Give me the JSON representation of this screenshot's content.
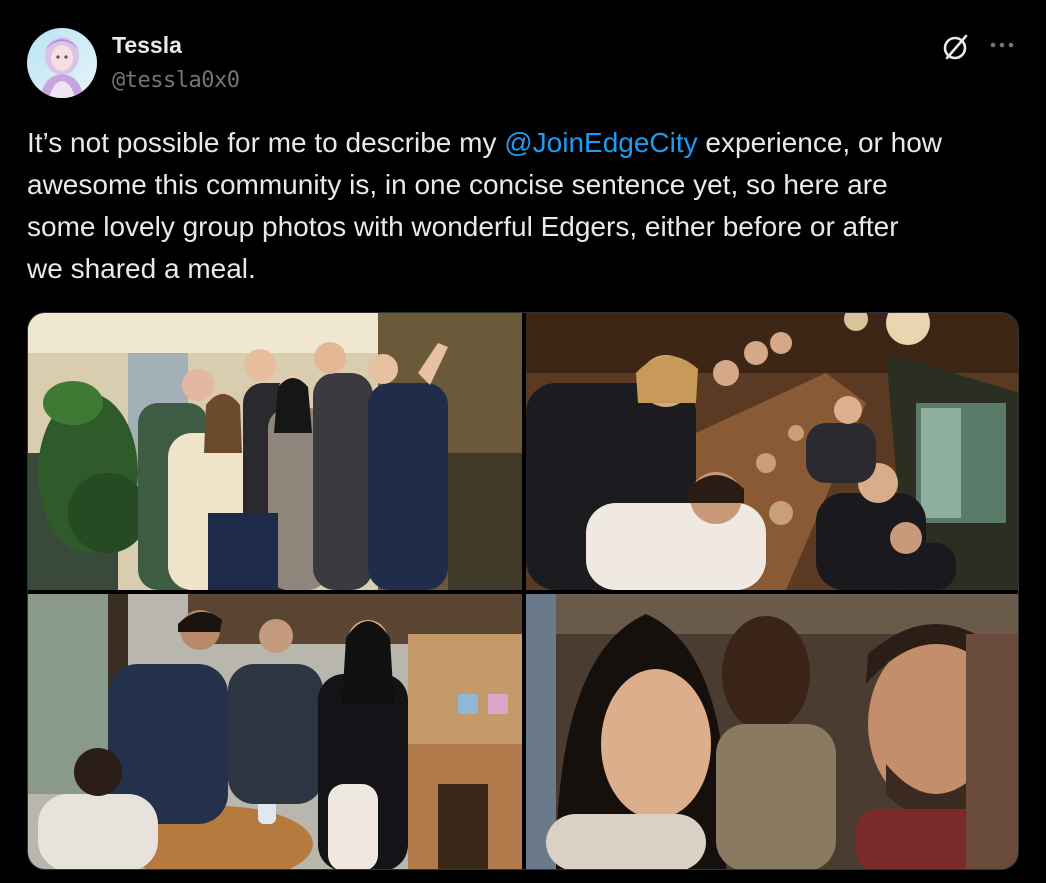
{
  "author": {
    "display_name": "Tessla",
    "handle": "@tessla0x0"
  },
  "tweet": {
    "lines": [
      {
        "before": "It’s not possible for me to describe my ",
        "mention": "@JoinEdgeCity",
        "after": " experience, or how"
      },
      {
        "text": "awesome this community is, in one concise sentence yet, so here are"
      },
      {
        "text": "some lovely group photos with wonderful Edgers, either before or after"
      },
      {
        "text": "we shared a meal."
      }
    ]
  },
  "icons": {
    "grok": "grok-slash-circle-icon",
    "more": "more-horizontal-icon"
  },
  "colors": {
    "background": "#000000",
    "text": "#e7e9ea",
    "secondary": "#71767b",
    "link": "#1d9bf0",
    "border": "#2f3336"
  },
  "media": {
    "photos": [
      {
        "id": "photo-1"
      },
      {
        "id": "photo-2"
      },
      {
        "id": "photo-3"
      },
      {
        "id": "photo-4"
      }
    ]
  }
}
